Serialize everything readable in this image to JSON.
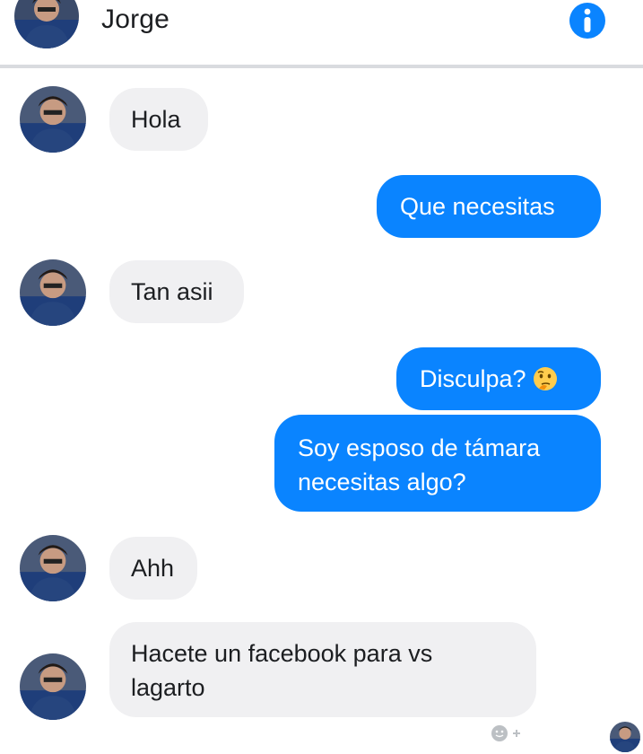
{
  "header": {
    "contact_name": "Jorge",
    "info_icon": "info-icon",
    "avatar_icon": "contact-avatar"
  },
  "colors": {
    "outgoing_bubble": "#0a84ff",
    "incoming_bubble": "#f0f0f2",
    "info_icon": "#0a84ff"
  },
  "messages": [
    {
      "from": "contact",
      "text": "Hola"
    },
    {
      "from": "me",
      "text": "Que necesitas"
    },
    {
      "from": "contact",
      "text": "Tan asii"
    },
    {
      "from": "me",
      "text": "Disculpa?",
      "emoji": "thinking-face-icon"
    },
    {
      "from": "me",
      "lines": [
        "Soy esposo de támara",
        "necesitas algo?"
      ]
    },
    {
      "from": "contact",
      "text": "Ahh"
    },
    {
      "from": "contact",
      "lines": [
        "Hacete un facebook para vs",
        "lagarto"
      ]
    }
  ],
  "footer": {
    "reaction_icon": "add-reaction-icon",
    "seen_icon": "seen-avatar"
  }
}
